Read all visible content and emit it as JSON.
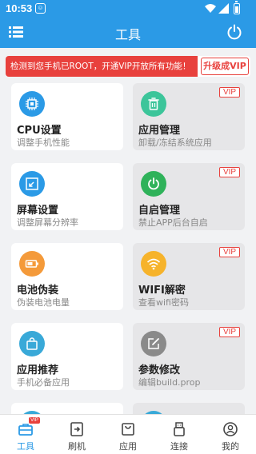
{
  "statusbar": {
    "time": "10:53",
    "app_icon": "notification-app-icon"
  },
  "header": {
    "title": "工具",
    "menu_icon": "menu-icon",
    "power_icon": "power-icon",
    "color": "#2b9ae6"
  },
  "banner": {
    "message": "检测到您手机已ROOT，开通VIP开放所有功能！",
    "upgrade_label": "升级成VIP",
    "color": "#e8413d"
  },
  "cards": [
    {
      "title": "CPU设置",
      "subtitle": "调整手机性能",
      "icon": "cpu-chip-icon",
      "icon_color": "#2b9ae6",
      "vip": "",
      "locked": false
    },
    {
      "title": "应用管理",
      "subtitle": "卸载/冻结系统应用",
      "icon": "trash-icon",
      "icon_color": "#3cc59a",
      "vip": "VIP",
      "locked": true
    },
    {
      "title": "屏幕设置",
      "subtitle": "调整屏幕分辨率",
      "icon": "screen-resize-icon",
      "icon_color": "#2b9ae6",
      "vip": "",
      "locked": false
    },
    {
      "title": "自启管理",
      "subtitle": "禁止APP后台自启",
      "icon": "power-toggle-icon",
      "icon_color": "#2fb25a",
      "vip": "VIP",
      "locked": true
    },
    {
      "title": "电池伪装",
      "subtitle": "伪装电池电量",
      "icon": "battery-icon",
      "icon_color": "#f49a3a",
      "vip": "",
      "locked": false
    },
    {
      "title": "WIFI解密",
      "subtitle": "查看wifi密码",
      "icon": "wifi-icon",
      "icon_color": "#f6b32b",
      "vip": "VIP",
      "locked": true
    },
    {
      "title": "应用推荐",
      "subtitle": "手机必备应用",
      "icon": "shopping-bag-icon",
      "icon_color": "#39a9d8",
      "vip": "",
      "locked": false
    },
    {
      "title": "参数修改",
      "subtitle": "编辑build.prop",
      "icon": "edit-icon",
      "icon_color": "#8a8a8a",
      "vip": "VIP",
      "locked": true
    }
  ],
  "tabs": [
    {
      "label": "工具",
      "icon": "toolbox-icon",
      "active": true,
      "badge": "VIP"
    },
    {
      "label": "刷机",
      "icon": "flash-icon",
      "active": false
    },
    {
      "label": "应用",
      "icon": "bag-icon",
      "active": false
    },
    {
      "label": "连接",
      "icon": "usb-icon",
      "active": false
    },
    {
      "label": "我的",
      "icon": "user-icon",
      "active": false
    }
  ]
}
